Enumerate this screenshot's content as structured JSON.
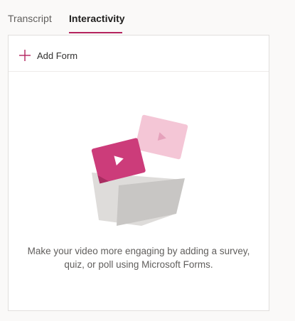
{
  "tabs": {
    "transcript": "Transcript",
    "interactivity": "Interactivity"
  },
  "panel": {
    "add_form_label": "Add Form",
    "empty_message": "Make your video more engaging by adding a survey, quiz, or poll using Microsoft Forms."
  },
  "colors": {
    "accent": "#b4235e",
    "card_front": "#cc3c7a",
    "card_back": "#f4c6d6",
    "folder": "#c8c6c4"
  },
  "icons": {
    "add": "plus-icon",
    "illustration": "video-forms-illustration"
  }
}
